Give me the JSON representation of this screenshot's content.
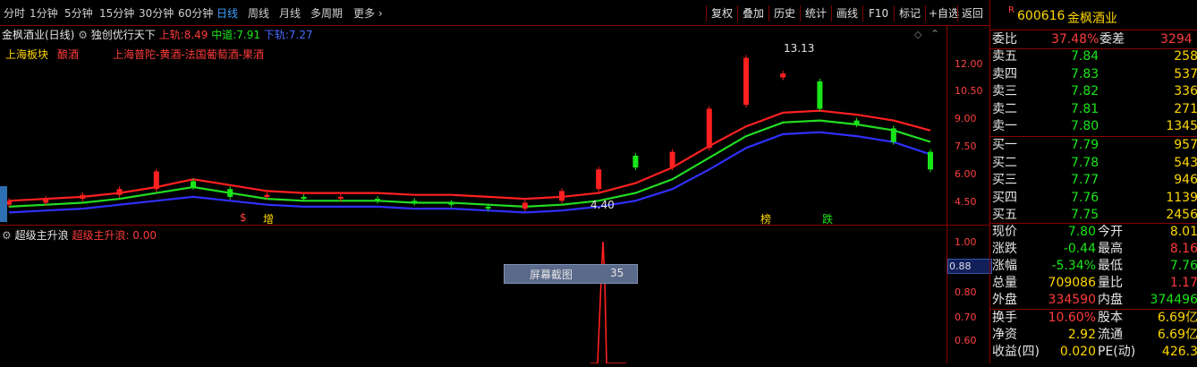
{
  "toolbar": {
    "periods": [
      "分时",
      "1分钟",
      "5分钟",
      "15分钟",
      "30分钟",
      "60分钟",
      "日线",
      "周线",
      "月线",
      "多周期",
      "更多 ›"
    ],
    "active_period": "日线",
    "right_buttons": [
      "复权",
      "叠加",
      "历史",
      "统计",
      "画线",
      "F10",
      "标记",
      "+自选",
      "返回"
    ]
  },
  "main": {
    "stock_title": "金枫酒业(日线)",
    "indicator_name": "独创优行天下",
    "upper_label": "上轨:",
    "upper_value": "8.49",
    "mid_label": "中道:",
    "mid_value": "7.91",
    "lower_label": "下轨:",
    "lower_value": "7.27",
    "sector_label": "上海板块",
    "industry_label": "酿酒",
    "concept_label": "上海普陀-黄酒-法国葡萄酒-果酒",
    "high_annotation": "13.13",
    "low_annotation": "4.40",
    "markers": [
      "$",
      "增",
      "榜",
      "跌"
    ]
  },
  "sub": {
    "indicator_name": "超级主升浪",
    "value_label": "超级主升浪: 0.00",
    "screenshot_label": "屏幕截图",
    "screenshot_value": "35"
  },
  "axis": {
    "main_ticks": [
      "12.00",
      "10.50",
      "9.00",
      "7.50",
      "6.00",
      "4.50"
    ],
    "sub_ticks": [
      "1.00",
      "0.88",
      "0.80",
      "0.70",
      "0.60"
    ]
  },
  "quote": {
    "flag": "R",
    "code": "600616",
    "name": "金枫酒业",
    "weibi_label": "委比",
    "weibi": "37.48%",
    "weicha_label": "委差",
    "weicha": "3294",
    "asks": [
      {
        "label": "卖五",
        "price": "7.84",
        "vol": "258"
      },
      {
        "label": "卖四",
        "price": "7.83",
        "vol": "537"
      },
      {
        "label": "卖三",
        "price": "7.82",
        "vol": "336"
      },
      {
        "label": "卖二",
        "price": "7.81",
        "vol": "271"
      },
      {
        "label": "卖一",
        "price": "7.80",
        "vol": "1345"
      }
    ],
    "bids": [
      {
        "label": "买一",
        "price": "7.79",
        "vol": "957"
      },
      {
        "label": "买二",
        "price": "7.78",
        "vol": "543"
      },
      {
        "label": "买三",
        "price": "7.77",
        "vol": "946"
      },
      {
        "label": "买四",
        "price": "7.76",
        "vol": "1139"
      },
      {
        "label": "买五",
        "price": "7.75",
        "vol": "2456"
      }
    ],
    "stats": [
      {
        "l1": "现价",
        "v1": "7.80",
        "l2": "今开",
        "v2": "8.01"
      },
      {
        "l1": "涨跌",
        "v1": "-0.44",
        "l2": "最高",
        "v2": "8.16"
      },
      {
        "l1": "涨幅",
        "v1": "-5.34%",
        "l2": "最低",
        "v2": "7.76"
      },
      {
        "l1": "总量",
        "v1": "709086",
        "l2": "量比",
        "v2": "1.17"
      },
      {
        "l1": "外盘",
        "v1": "334590",
        "l2": "内盘",
        "v2": "374496"
      },
      {
        "l1": "换手",
        "v1": "10.60%",
        "l2": "股本",
        "v2": "6.69亿"
      },
      {
        "l1": "净资",
        "v1": "2.92",
        "l2": "流通",
        "v2": "6.69亿"
      },
      {
        "l1": "收益(四)",
        "v1": "0.020",
        "l2": "PE(动)",
        "v2": "426.3"
      }
    ]
  },
  "chart_data": {
    "type": "line",
    "title": "金枫酒业(日线)",
    "ylim": [
      4.0,
      13.6
    ],
    "series": [
      {
        "name": "上轨",
        "color": "#ff2020",
        "values": [
          4.9,
          5.0,
          5.1,
          5.3,
          5.6,
          6.0,
          5.7,
          5.4,
          5.3,
          5.3,
          5.3,
          5.2,
          5.2,
          5.1,
          5.0,
          5.1,
          5.3,
          5.8,
          6.6,
          7.7,
          8.7,
          9.4,
          9.5,
          9.3,
          9.0,
          8.49
        ]
      },
      {
        "name": "中道",
        "color": "#22dd22",
        "values": [
          4.6,
          4.7,
          4.8,
          5.0,
          5.3,
          5.6,
          5.3,
          5.0,
          4.9,
          4.9,
          4.9,
          4.8,
          4.8,
          4.7,
          4.6,
          4.7,
          4.9,
          5.3,
          6.0,
          7.1,
          8.2,
          8.9,
          9.0,
          8.8,
          8.5,
          7.91
        ]
      },
      {
        "name": "下轨",
        "color": "#3030ff",
        "values": [
          4.3,
          4.4,
          4.5,
          4.7,
          4.9,
          5.1,
          4.9,
          4.7,
          4.6,
          4.6,
          4.6,
          4.5,
          4.5,
          4.4,
          4.3,
          4.4,
          4.6,
          4.9,
          5.5,
          6.5,
          7.6,
          8.3,
          8.4,
          8.2,
          7.9,
          7.27
        ]
      }
    ],
    "candles": [
      {
        "o": 4.7,
        "c": 4.9
      },
      {
        "o": 4.8,
        "c": 5.0
      },
      {
        "o": 5.0,
        "c": 5.2
      },
      {
        "o": 5.2,
        "c": 5.5
      },
      {
        "o": 5.5,
        "c": 6.4
      },
      {
        "o": 5.9,
        "c": 5.6
      },
      {
        "o": 5.5,
        "c": 5.1
      },
      {
        "o": 5.1,
        "c": 5.2
      },
      {
        "o": 5.1,
        "c": 5.0
      },
      {
        "o": 5.0,
        "c": 5.1
      },
      {
        "o": 5.0,
        "c": 4.9
      },
      {
        "o": 4.9,
        "c": 4.8
      },
      {
        "o": 4.8,
        "c": 4.7
      },
      {
        "o": 4.6,
        "c": 4.5
      },
      {
        "o": 4.5,
        "c": 4.8
      },
      {
        "o": 4.9,
        "c": 5.4
      },
      {
        "o": 5.5,
        "c": 6.5
      },
      {
        "o": 7.2,
        "c": 6.6
      },
      {
        "o": 6.6,
        "c": 7.4
      },
      {
        "o": 7.6,
        "c": 9.6
      },
      {
        "o": 9.8,
        "c": 12.2
      },
      {
        "o": 11.2,
        "c": 11.4
      },
      {
        "o": 11.0,
        "c": 9.6
      },
      {
        "o": 9.0,
        "c": 8.8
      },
      {
        "o": 8.6,
        "c": 7.9
      },
      {
        "o": 7.4,
        "c": 6.5
      }
    ],
    "sub_series": {
      "name": "超级主升浪",
      "peak": 1.0
    }
  }
}
